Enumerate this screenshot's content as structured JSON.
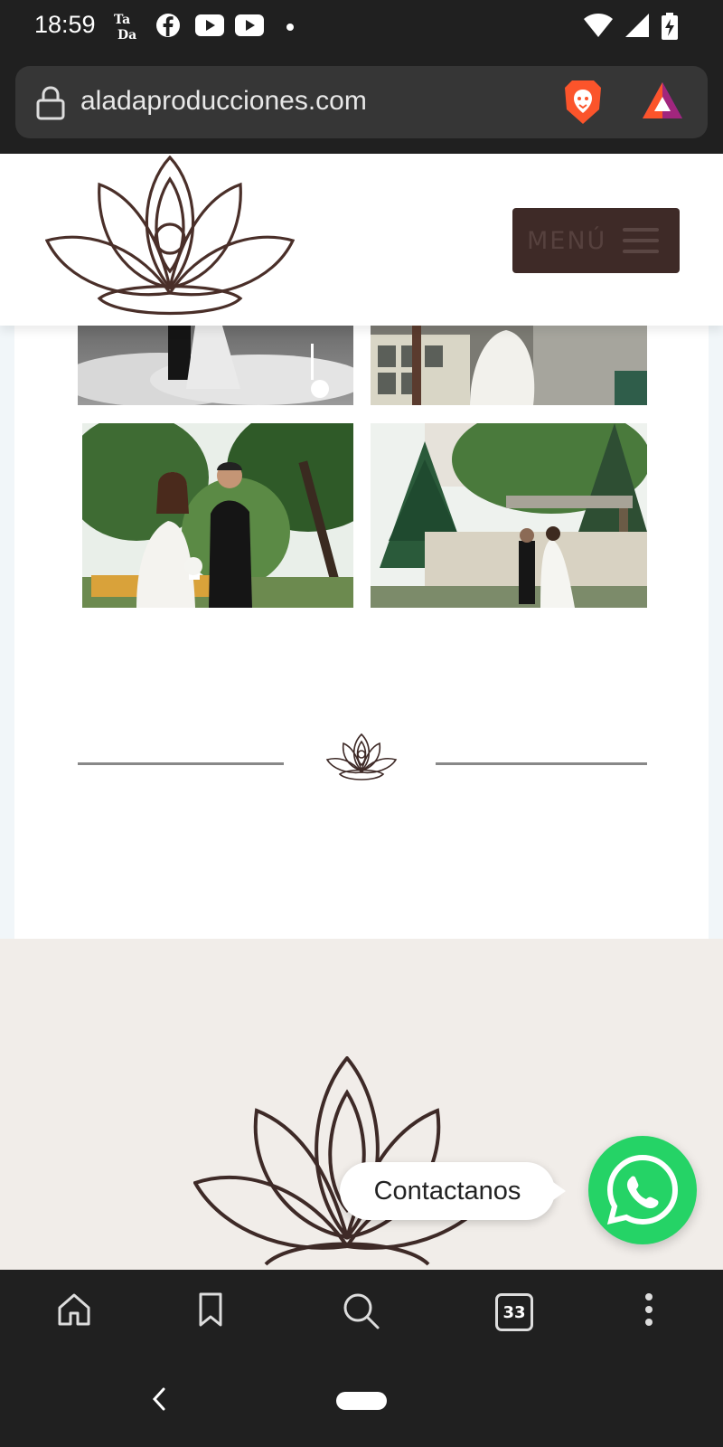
{
  "status_bar": {
    "time": "18:59",
    "app_icons": [
      "tada-icon",
      "facebook-icon",
      "youtube-icon",
      "youtube-icon",
      "dot-icon"
    ],
    "right_icons": [
      "wifi-icon",
      "signal-icon",
      "battery-charging-icon"
    ]
  },
  "browser": {
    "url": "aladaproducciones.com",
    "lock_icon": "lock-icon",
    "shield_icon": "brave-shields-icon",
    "rewards_icon": "brave-rewards-icon"
  },
  "site": {
    "menu_label": "MENÚ",
    "brand_color": "#3e2a27"
  },
  "gallery": {
    "photos": [
      "photo-1",
      "photo-2",
      "photo-3",
      "photo-4"
    ]
  },
  "whatsapp": {
    "label": "Contactanos",
    "color": "#25d366"
  },
  "toolbar": {
    "tabs_count": "33",
    "icons": [
      "home-icon",
      "bookmark-icon",
      "search-icon",
      "tabs-icon",
      "more-icon"
    ]
  },
  "navbar": {
    "icons": [
      "back-icon",
      "home-pill"
    ]
  }
}
